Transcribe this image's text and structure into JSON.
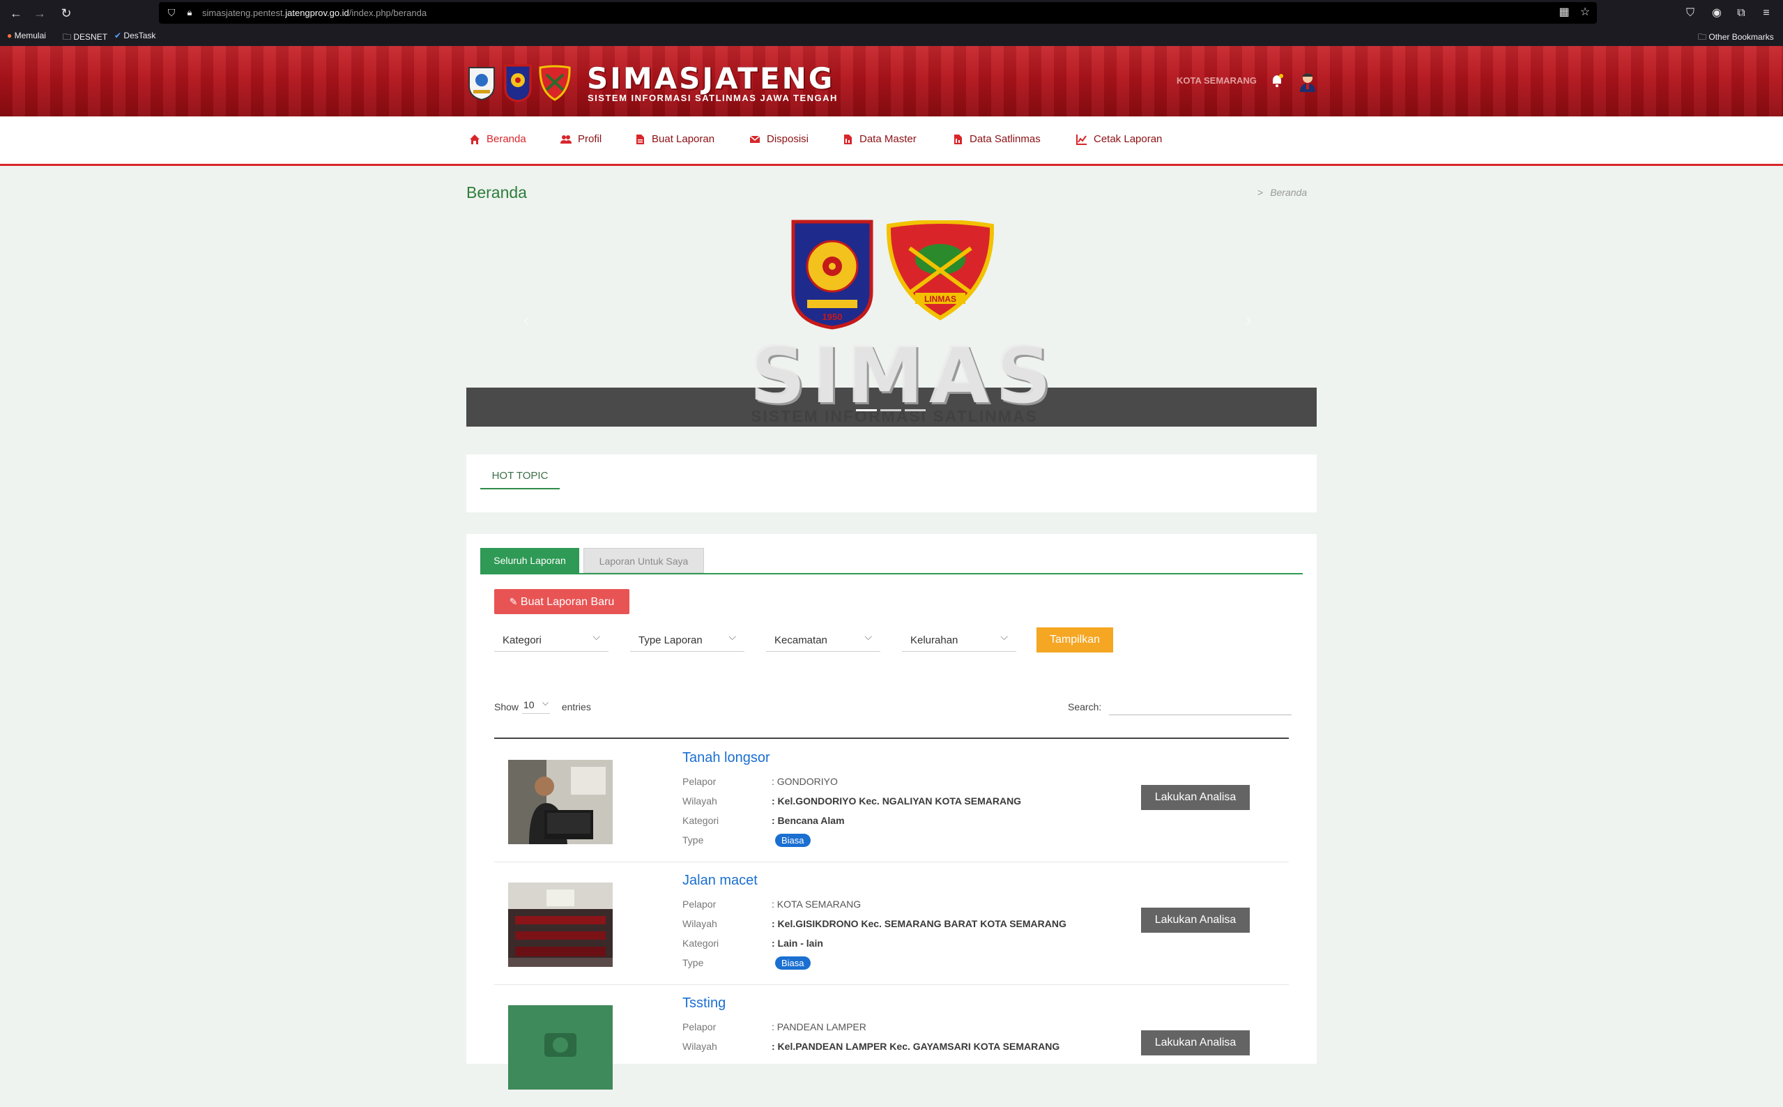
{
  "browser": {
    "url_prefix": "simasjateng.pentest.",
    "url_domain": "jatengprov.go.id",
    "url_path": "/index.php/beranda",
    "bookmarks": [
      "Memulai",
      "DESNET",
      "DesTask"
    ],
    "other_bookmarks": "Other Bookmarks"
  },
  "header": {
    "title": "SIMASJATENG",
    "subtitle": "SISTEM INFORMASI SATLINMAS JAWA TENGAH",
    "region": "KOTA SEMARANG"
  },
  "nav": {
    "items": [
      "Beranda",
      "Profil",
      "Buat Laporan",
      "Disposisi",
      "Data Master",
      "Data Satlinmas",
      "Cetak Laporan"
    ]
  },
  "page": {
    "title": "Beranda",
    "breadcrumb_sep": ">",
    "breadcrumb": "Beranda"
  },
  "carousel": {
    "banner_text": "SIMAS",
    "banner_sub": "SISTEM INFORMASI SATLINMAS",
    "logo_left_text": "1950",
    "logo_right_text": "LINMAS",
    "slides": 3,
    "active_slide": 1
  },
  "hot_topic": {
    "tab_label": "HOT TOPIC"
  },
  "reports": {
    "tabs": [
      "Seluruh Laporan",
      "Laporan Untuk Saya"
    ],
    "new_button": "Buat Laporan Baru",
    "filters": [
      "Kategori",
      "Type Laporan",
      "Kecamatan",
      "Kelurahan"
    ],
    "show_button": "Tampilkan",
    "show_label": "Show",
    "entries_value": "10",
    "entries_label": "entries",
    "search_label": "Search:",
    "search_value": "",
    "field_labels": {
      "reporter": "Pelapor",
      "region": "Wilayah",
      "category": "Kategori",
      "type": "Type"
    },
    "analyze_label": "Lakukan Analisa",
    "items": [
      {
        "title": "Tanah longsor",
        "reporter": ": GONDORIYO",
        "region": ": Kel.GONDORIYO Kec. NGALIYAN KOTA SEMARANG",
        "category": ": Bencana Alam",
        "type": "Biasa"
      },
      {
        "title": "Jalan macet",
        "reporter": ": KOTA SEMARANG",
        "region": ": Kel.GISIKDRONO Kec. SEMARANG BARAT KOTA SEMARANG",
        "category": ": Lain - lain",
        "type": "Biasa"
      },
      {
        "title": "Tssting",
        "reporter": ": PANDEAN LAMPER",
        "region": ": Kel.PANDEAN LAMPER Kec. GAYAMSARI KOTA SEMARANG",
        "category": "",
        "type": ""
      }
    ]
  },
  "colors": {
    "brand_red": "#d9252a",
    "accent_green": "#2e9a55",
    "link_blue": "#1a6fd1",
    "show_orange": "#f5a623"
  }
}
